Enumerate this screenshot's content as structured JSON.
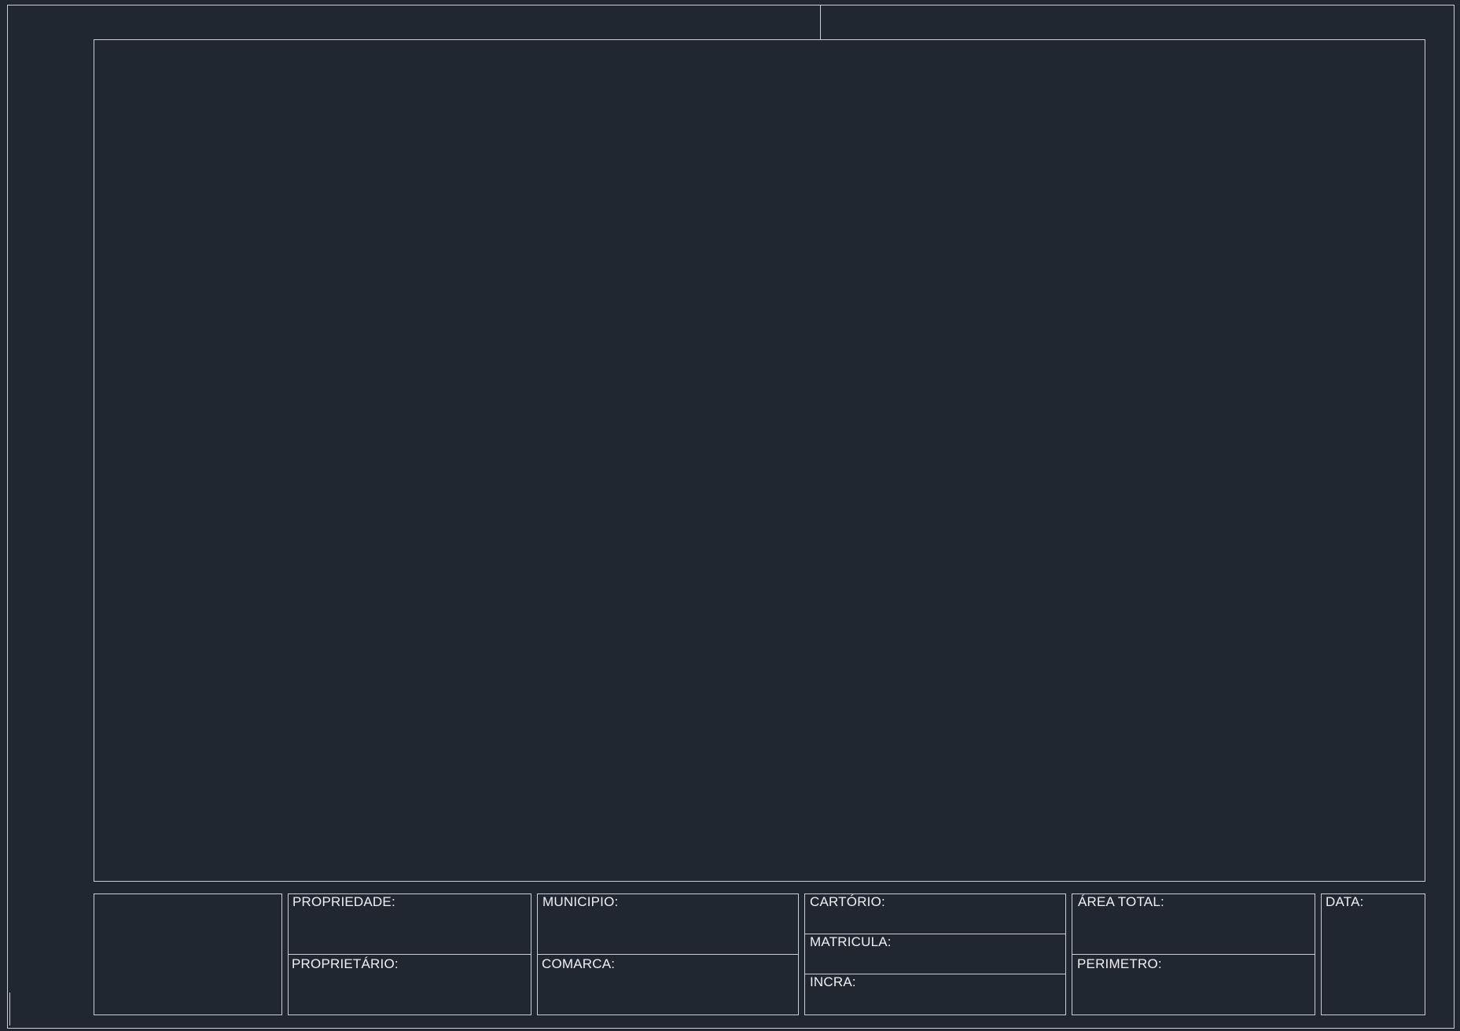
{
  "title_block": {
    "propriedade_label": "PROPRIEDADE:",
    "proprietario_label": "PROPRIETÁRIO:",
    "municipio_label": "MUNICIPIO:",
    "comarca_label": "COMARCA:",
    "cartorio_label": "CARTÓRIO:",
    "matricula_label": "MATRICULA:",
    "incra_label": "INCRA:",
    "area_total_label": "ÁREA TOTAL:",
    "perimetro_label": "PERIMETRO:",
    "data_label": "DATA:"
  },
  "colors": {
    "background": "#212730",
    "line": "#c9ced6",
    "text": "#eef0f4"
  }
}
